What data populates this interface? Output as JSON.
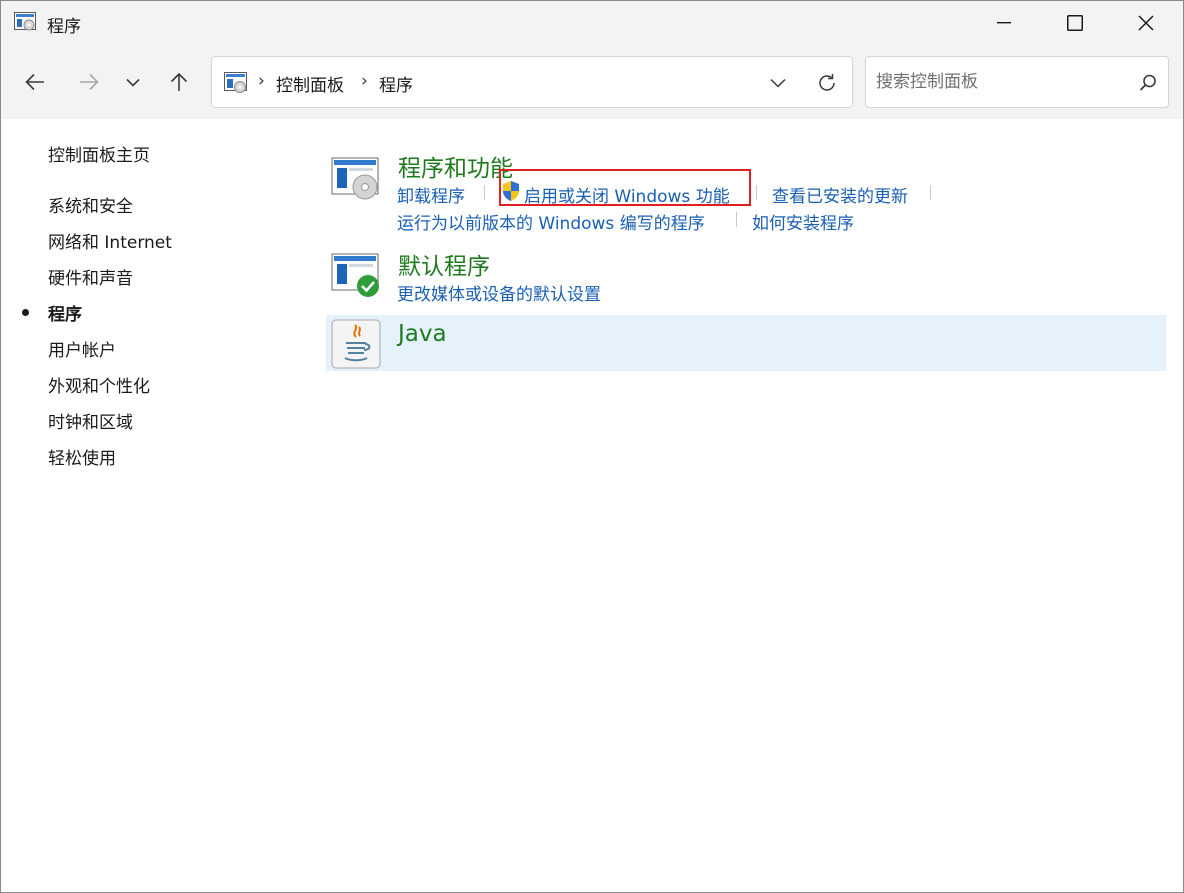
{
  "window": {
    "title": "程序"
  },
  "navigation": {
    "breadcrumb": [
      "控制面板",
      "程序"
    ],
    "search": {
      "placeholder": "搜索控制面板"
    }
  },
  "sidebar": {
    "items": [
      {
        "label": "控制面板主页",
        "active": false
      },
      {
        "label": "系统和安全",
        "active": false
      },
      {
        "label": "网络和 Internet",
        "active": false
      },
      {
        "label": "硬件和声音",
        "active": false
      },
      {
        "label": "程序",
        "active": true
      },
      {
        "label": "用户帐户",
        "active": false
      },
      {
        "label": "外观和个性化",
        "active": false
      },
      {
        "label": "时钟和区域",
        "active": false
      },
      {
        "label": "轻松使用",
        "active": false
      }
    ]
  },
  "main": {
    "categories": [
      {
        "title": "程序和功能",
        "icon": "programs-features-icon",
        "links": [
          "卸载程序",
          "启用或关闭 Windows 功能",
          "查看已安装的更新",
          "运行为以前版本的 Windows 编写的程序",
          "如何安装程序"
        ]
      },
      {
        "title": "默认程序",
        "icon": "default-programs-icon",
        "links": [
          "更改媒体或设备的默认设置"
        ]
      },
      {
        "title": "Java",
        "icon": "java-icon",
        "links": []
      }
    ]
  },
  "colors": {
    "category_title": "#1e7a1e",
    "link": "#1a5fb4",
    "highlight": "#e02020",
    "hover_row": "#e5f1fb",
    "chrome": "#f3f3f3"
  }
}
